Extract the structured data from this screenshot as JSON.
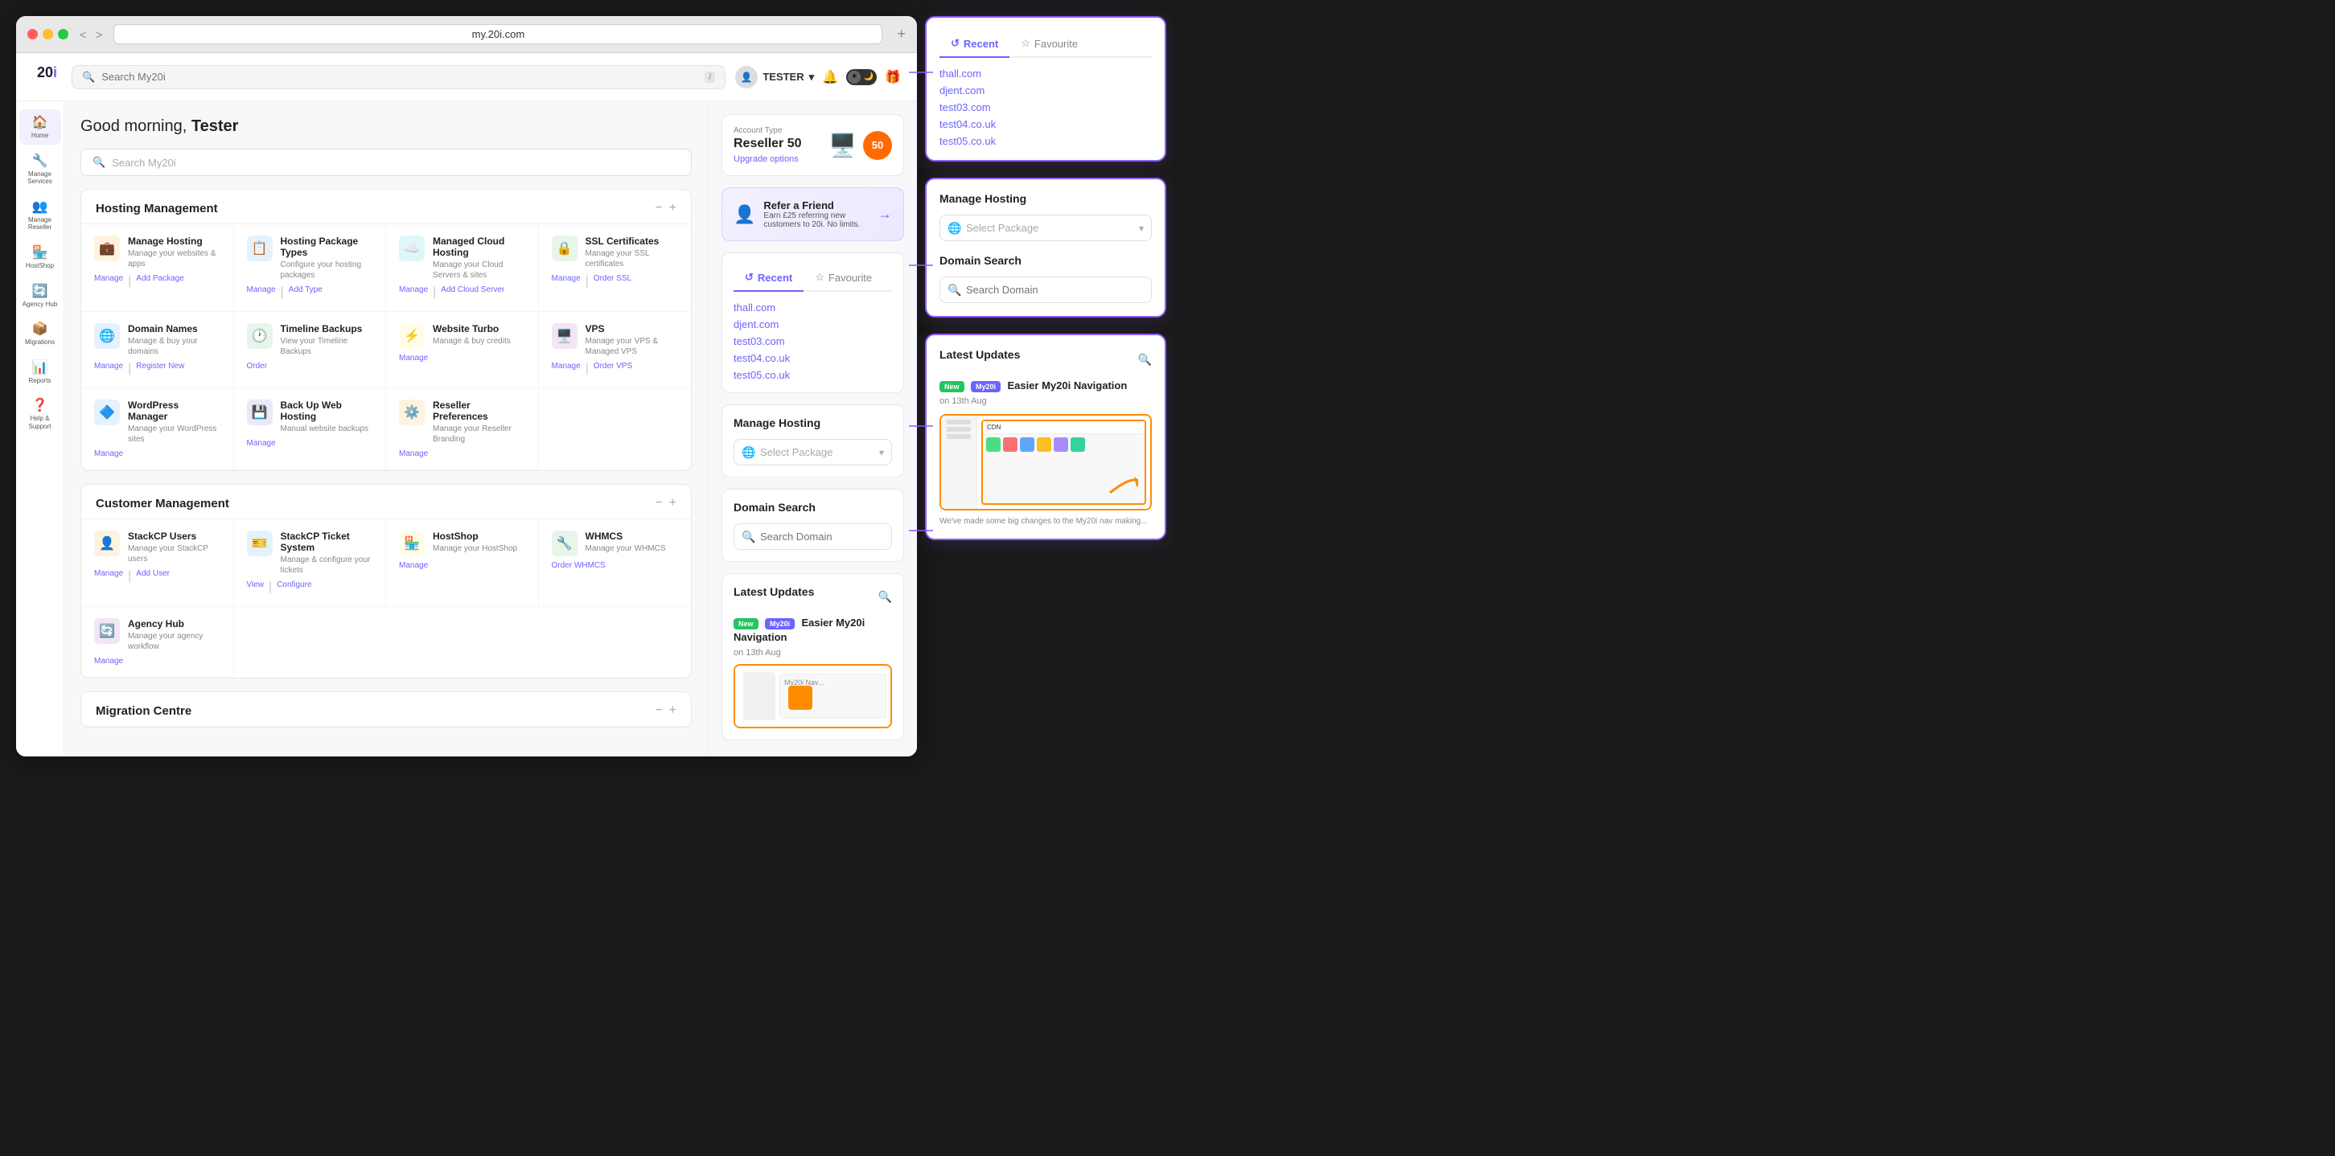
{
  "browser": {
    "url": "my.20i.com",
    "back": "<",
    "forward": ">",
    "add": "+"
  },
  "header": {
    "search_placeholder": "Search My20i",
    "kbd": "/",
    "user": "TESTER",
    "greeting": "Good morning,",
    "name": "Tester"
  },
  "sidebar": {
    "logo": "20i",
    "items": [
      {
        "id": "home",
        "label": "Home",
        "icon": "🏠"
      },
      {
        "id": "manage-services",
        "label": "Manage Services",
        "icon": "🔧"
      },
      {
        "id": "manage-reseller",
        "label": "Manage Reseller",
        "icon": "👥"
      },
      {
        "id": "hostshop",
        "label": "HostShop",
        "icon": "🏪"
      },
      {
        "id": "agency-hub",
        "label": "Agency Hub",
        "icon": "🔄"
      },
      {
        "id": "migrations",
        "label": "Migrations",
        "icon": "📦"
      },
      {
        "id": "reports",
        "label": "Reports",
        "icon": "📊"
      },
      {
        "id": "help-support",
        "label": "Help & Support",
        "icon": "❓"
      }
    ]
  },
  "account": {
    "label": "Account Type",
    "type": "Reseller 50",
    "upgrade": "Upgrade options",
    "badge": "50"
  },
  "refer": {
    "title": "Refer a Friend",
    "desc": "Earn £25 referring new customers to 20i. No limits.",
    "icon": "👤"
  },
  "recent_favourite": {
    "recent_tab": "Recent",
    "favourite_tab": "Favourite",
    "domains": [
      "thall.com",
      "djent.com",
      "test03.com",
      "test04.co.uk",
      "test05.co.uk"
    ]
  },
  "manage_hosting": {
    "title": "Manage Hosting",
    "select_placeholder": "Select Package"
  },
  "domain_search": {
    "title": "Domain Search",
    "placeholder": "Search Domain"
  },
  "latest_updates": {
    "title": "Latest Updates",
    "badge_new": "New",
    "badge_my20i": "My20i",
    "update_title": "Easier My20i Navigation",
    "update_date": "on 13th Aug"
  },
  "content_search": {
    "placeholder": "Search My20i"
  },
  "hosting_management": {
    "title": "Hosting Management",
    "items": [
      {
        "id": "manage-hosting",
        "title": "Manage Hosting",
        "desc": "Manage your websites & apps",
        "links": [
          "Manage",
          "Add Package"
        ],
        "icon": "💼",
        "icon_class": "icon-orange"
      },
      {
        "id": "hosting-package-types",
        "title": "Hosting Package Types",
        "desc": "Configure your hosting packages",
        "links": [
          "Manage",
          "Add Type"
        ],
        "icon": "📋",
        "icon_class": "icon-blue"
      },
      {
        "id": "managed-cloud-hosting",
        "title": "Managed Cloud Hosting",
        "desc": "Manage your Cloud Servers & sites",
        "links": [
          "Manage",
          "Add Cloud Server"
        ],
        "icon": "☁️",
        "icon_class": "icon-teal"
      },
      {
        "id": "ssl-certificates",
        "title": "SSL Certificates",
        "desc": "Manage your SSL certificates",
        "links": [
          "Manage",
          "Order SSL"
        ],
        "icon": "🔒",
        "icon_class": "icon-green"
      },
      {
        "id": "domain-names",
        "title": "Domain Names",
        "desc": "Manage & buy your domains",
        "links": [
          "Manage",
          "Register New"
        ],
        "icon": "🌐",
        "icon_class": "icon-blue"
      },
      {
        "id": "timeline-backups",
        "title": "Timeline Backups",
        "desc": "View your Timeline Backups",
        "links": [
          "Order"
        ],
        "icon": "🕐",
        "icon_class": "icon-green"
      },
      {
        "id": "website-turbo",
        "title": "Website Turbo",
        "desc": "Manage & buy credits",
        "links": [
          "Manage"
        ],
        "icon": "⚡",
        "icon_class": "icon-yellow"
      },
      {
        "id": "vps",
        "title": "VPS",
        "desc": "Manage your VPS & Managed VPS",
        "links": [
          "Manage",
          "Order VPS"
        ],
        "icon": "🖥️",
        "icon_class": "icon-purple"
      },
      {
        "id": "wordpress-manager",
        "title": "WordPress Manager",
        "desc": "Manage your WordPress sites",
        "links": [
          "Manage"
        ],
        "icon": "🔷",
        "icon_class": "icon-blue"
      },
      {
        "id": "back-up-web-hosting",
        "title": "Back Up Web Hosting",
        "desc": "Manual website backups",
        "links": [
          "Manage"
        ],
        "icon": "💾",
        "icon_class": "icon-indigo"
      },
      {
        "id": "reseller-preferences",
        "title": "Reseller Preferences",
        "desc": "Manage your Reseller Branding",
        "links": [
          "Manage"
        ],
        "icon": "⚙️",
        "icon_class": "icon-orange"
      }
    ]
  },
  "customer_management": {
    "title": "Customer Management",
    "items": [
      {
        "id": "stackcp-users",
        "title": "StackCP Users",
        "desc": "Manage your StackCP users",
        "links": [
          "Manage",
          "Add User"
        ],
        "icon": "👤",
        "icon_class": "icon-orange"
      },
      {
        "id": "stackcp-ticket-system",
        "title": "StackCP Ticket System",
        "desc": "Manage & configure your tickets",
        "links": [
          "View",
          "Configure"
        ],
        "icon": "🎫",
        "icon_class": "icon-blue"
      },
      {
        "id": "hostshop",
        "title": "HostShop",
        "desc": "Manage your HostShop",
        "links": [
          "Manage"
        ],
        "icon": "🏪",
        "icon_class": "icon-yellow"
      },
      {
        "id": "whmcs",
        "title": "WHMCS",
        "desc": "Manage your WHMCS",
        "links": [
          "Order WHMCS"
        ],
        "icon": "🔧",
        "icon_class": "icon-green"
      },
      {
        "id": "agency-hub",
        "title": "Agency Hub",
        "desc": "Manage your agency workflow",
        "links": [
          "Manage"
        ],
        "icon": "🔄",
        "icon_class": "icon-purple"
      }
    ]
  },
  "migration_centre": {
    "title": "Migration Centre"
  }
}
